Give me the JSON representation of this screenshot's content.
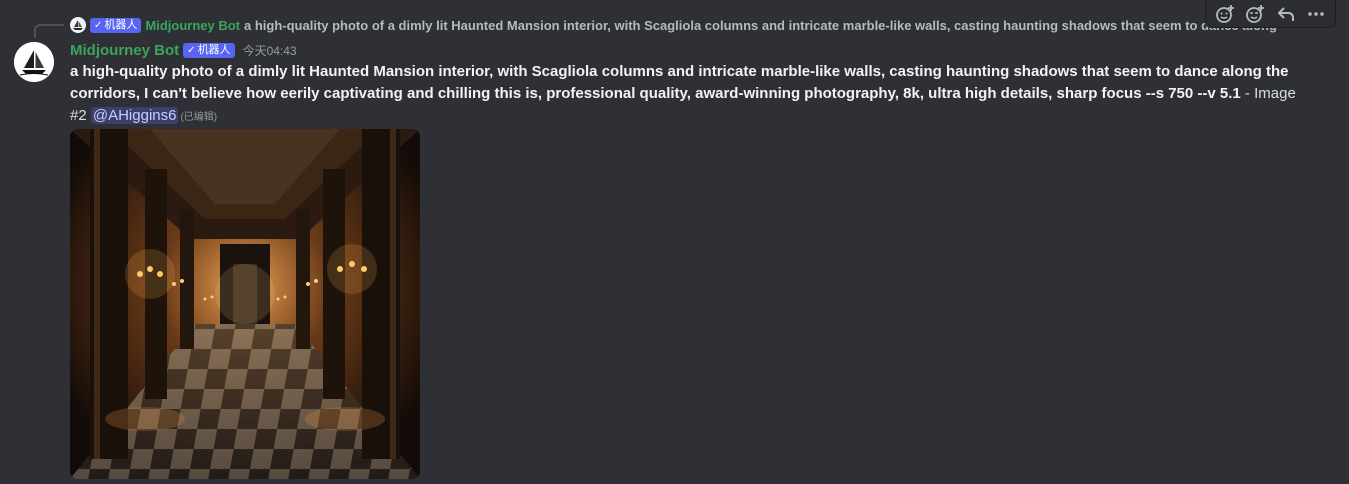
{
  "reply": {
    "author": "Midjourney Bot",
    "bot_tag": "机器人",
    "text": "a high-quality photo of a dimly lit Haunted Mansion interior, with Scagliola columns and intricate marble-like walls, casting haunting shadows that seem to dance along"
  },
  "message": {
    "author": "Midjourney Bot",
    "bot_tag": "机器人",
    "timestamp": "今天04:43",
    "prompt": "a high-quality photo of a dimly lit Haunted Mansion interior, with Scagliola columns and intricate marble-like walls, casting haunting shadows that seem to dance along the corridors, I can't believe how eerily captivating and chilling this is, professional quality, award-winning photography, 8k, ultra high details, sharp focus --s 750 --v 5.1",
    "suffix": " - Image #2 ",
    "mention": "@AHiggins6",
    "edited": "(已编辑)"
  },
  "toolbar": {
    "icons": [
      "add-reaction-icon",
      "super-reaction-icon",
      "reply-icon",
      "more-icon"
    ]
  },
  "colors": {
    "background": "#313338",
    "author": "#3ba55c",
    "bot_tag": "#5865f2",
    "mention_bg": "#3c4270"
  }
}
